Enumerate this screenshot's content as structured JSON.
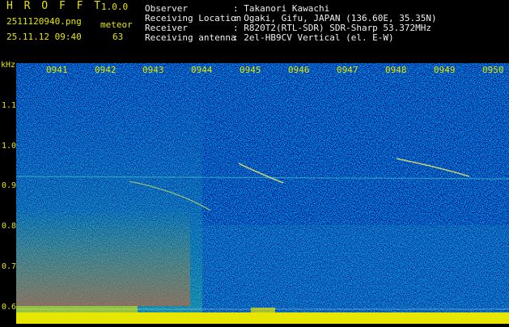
{
  "header": {
    "app_title": "H R O F F T",
    "version": "1.0.0",
    "filename": "2511120940.png",
    "datetime": "25.11.12 09:40",
    "type_label": "meteor",
    "count": "63"
  },
  "info": [
    {
      "key": "Observer",
      "value": ": Takanori Kawachi"
    },
    {
      "key": "Receiving Location",
      "value": ": Ogaki, Gifu, JAPAN (136.60E, 35.35N)"
    },
    {
      "key": "Receiver",
      "value": ": R820T2(RTL-SDR) SDR-Sharp 53.372MHz"
    },
    {
      "key": "Receiving antenna",
      "value": ": 2el-HB9CV Vertical (el. E-W)"
    }
  ],
  "axis": {
    "unit": "kHz",
    "x_ticks": [
      "0941",
      "0942",
      "0943",
      "0944",
      "0945",
      "0946",
      "0947",
      "0948",
      "0949",
      "0950"
    ],
    "y_ticks": [
      "1.1",
      "1.0",
      "0.9",
      "0.8",
      "0.7",
      "0.6"
    ]
  },
  "colors": {
    "label": "#e6e600",
    "text": "#f0f0f0",
    "background": "#06148a"
  }
}
